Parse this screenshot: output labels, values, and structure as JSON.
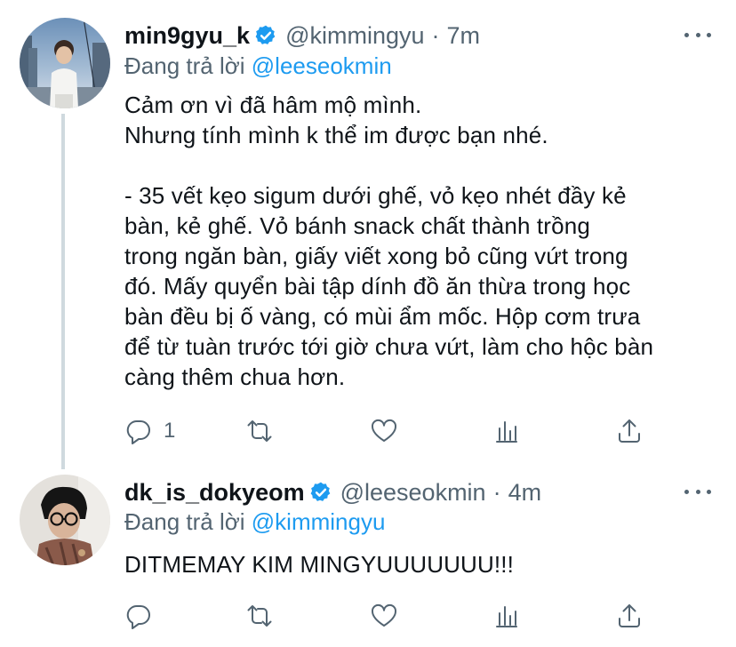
{
  "tweets": [
    {
      "display_name": "min9gyu_k",
      "handle": "@kimmingyu",
      "separator": "·",
      "time": "7m",
      "replying_prefix": "Đang trả lời ",
      "replying_to": "@leeseokmin",
      "text": "Cảm ơn vì đã hâm mộ mình.\nNhưng tính mình k thể im được bạn nhé.\n\n- 35 vết kẹo sigum dưới ghế, vỏ kẹo nhét đầy kẻ\nbàn, kẻ ghế. Vỏ bánh snack chất thành trồng\ntrong ngăn bàn, giấy viết xong bỏ cũng vứt trong\nđó. Mấy quyển bài tập dính đồ ăn thừa trong học\nbàn đều bị ố vàng, có mùi ẩm mốc. Hộp cơm trưa\nđể từ tuàn trước tới giờ chưa vứt, làm cho hộc bàn\ncàng thêm chua hơn.",
      "reply_count": "1"
    },
    {
      "display_name": "dk_is_dokyeom",
      "handle": "@leeseokmin",
      "separator": "·",
      "time": "4m",
      "replying_prefix": "Đang trả lời ",
      "replying_to": "@kimmingyu",
      "text": "DITMEMAY KIM MINGYUUUUUUU!!!",
      "reply_count": ""
    }
  ],
  "colors": {
    "text": "#0f1419",
    "secondary": "#536471",
    "link": "#1d9bf0",
    "verified": "#1d9bf0",
    "thread_line": "#cfd9de"
  },
  "icons": [
    "reply-icon",
    "retweet-icon",
    "like-icon",
    "analytics-icon",
    "share-icon",
    "verified-badge-icon",
    "more-options-icon"
  ]
}
